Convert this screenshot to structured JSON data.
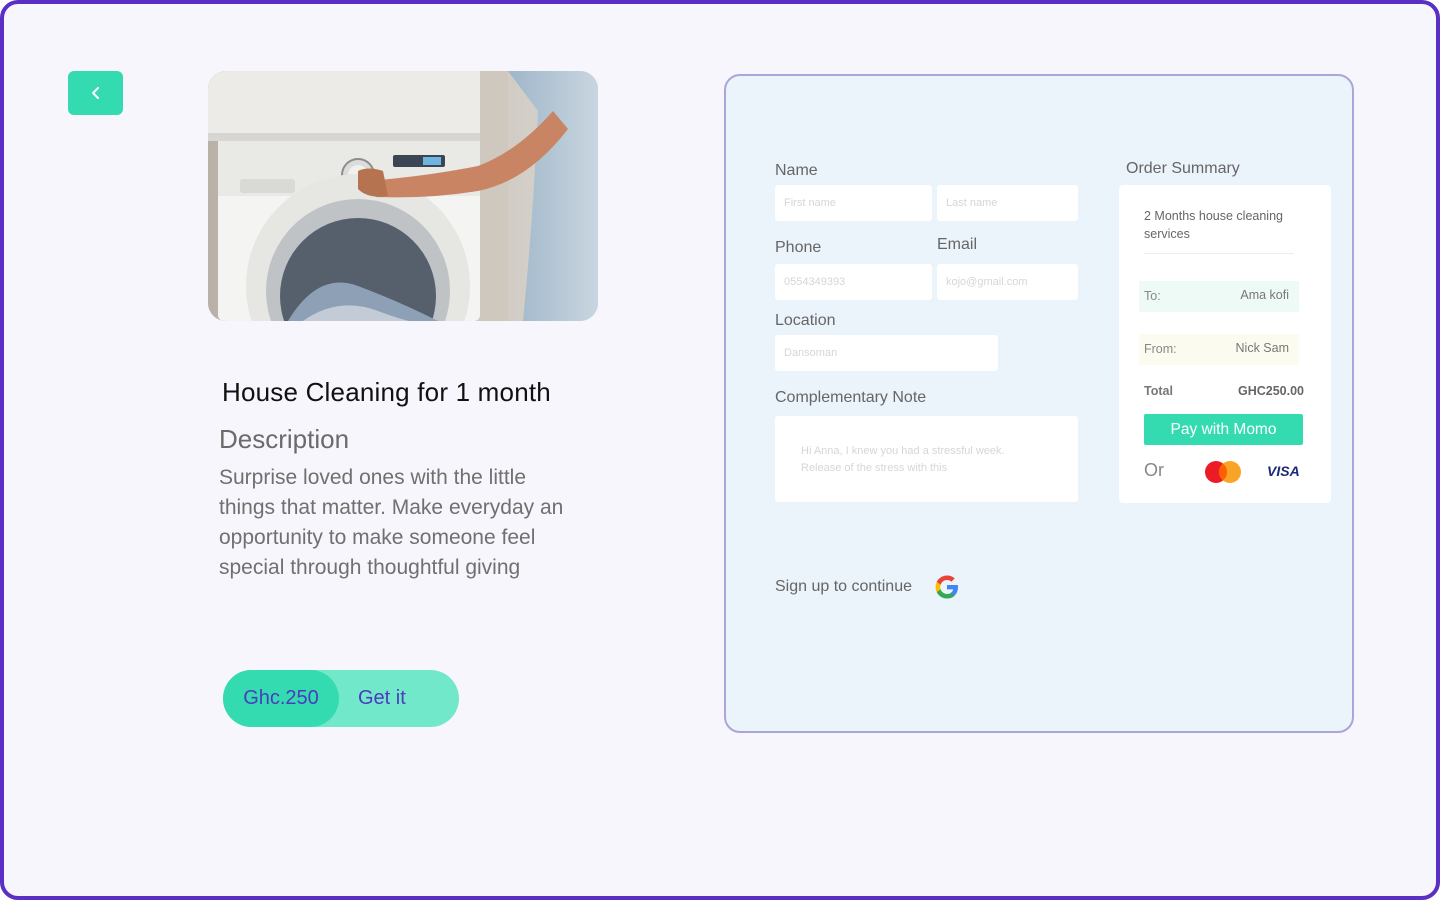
{
  "nav": {
    "back_icon": "chevron-left-icon"
  },
  "product": {
    "image_alt": "Person operating a washing machine",
    "title": "House Cleaning for 1 month",
    "description_heading": "Description",
    "description": "Surprise loved ones with the little things that matter. Make everyday an opportunity to make someone feel special through thoughtful giving",
    "price": "Ghc.250",
    "cta_label": "Get it"
  },
  "form": {
    "name_label": "Name",
    "first_name_placeholder": "First name",
    "last_name_placeholder": "Last name",
    "phone_label": "Phone",
    "phone_placeholder": "0554349393",
    "email_label": "Email",
    "email_placeholder": "kojo@gmail.com",
    "location_label": "Location",
    "location_placeholder": "Dansoman",
    "note_label": "Complementary Note",
    "note_line1": "Hi Anna, I knew you had a stressful week.",
    "note_line2": "Release of the stress with this",
    "signup_label": "Sign up to continue"
  },
  "summary": {
    "heading": "Order Summary",
    "service": "2 Months house cleaning services",
    "to_label": "To:",
    "to_value": "Ama kofi",
    "from_label": "From:",
    "from_value": "Nick Sam",
    "total_label": "Total",
    "total_value": "GHC250.00",
    "pay_button": "Pay with Momo",
    "or_label": "Or",
    "visa_label": "VISA"
  },
  "colors": {
    "accent": "#35dbb0",
    "accent_light": "#72e8ca",
    "brand_purple": "#4b3bbf",
    "frame_border": "#5a2fc4",
    "panel_bg": "#ebf3fb"
  }
}
